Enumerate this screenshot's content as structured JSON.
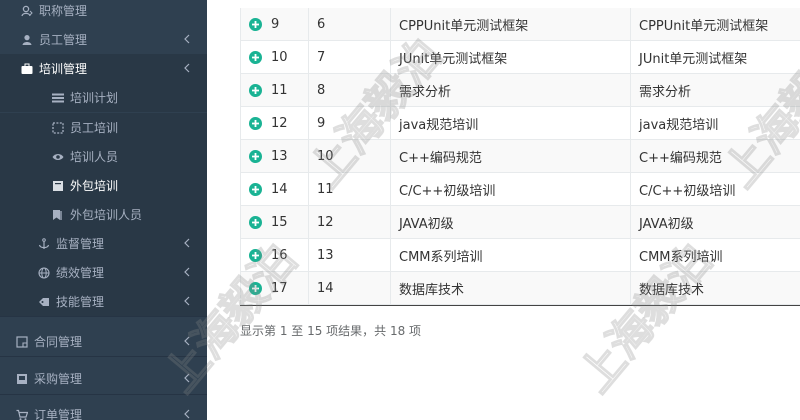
{
  "sidebar": {
    "items": [
      {
        "label": "职称管理",
        "icon": "user-tag-icon"
      },
      {
        "label": "员工管理",
        "icon": "user-icon"
      },
      {
        "label": "培训管理",
        "icon": "briefcase-icon"
      },
      {
        "label": "培训计划",
        "icon": "list-icon"
      },
      {
        "label": "员工培训",
        "icon": "crop-icon"
      },
      {
        "label": "培训人员",
        "icon": "eye-icon"
      },
      {
        "label": "外包培训",
        "icon": "book-icon"
      },
      {
        "label": "外包培训人员",
        "icon": "bookmark-icon"
      },
      {
        "label": "监督管理",
        "icon": "anchor-icon"
      },
      {
        "label": "绩效管理",
        "icon": "globe-icon"
      },
      {
        "label": "技能管理",
        "icon": "tag-icon"
      },
      {
        "label": "合同管理",
        "icon": "file-icon"
      },
      {
        "label": "采购管理",
        "icon": "inbox-icon"
      },
      {
        "label": "订单管理",
        "icon": "cart-icon"
      }
    ]
  },
  "table": {
    "rows": [
      {
        "no": "9",
        "id": "6",
        "name": "CPPUnit单元测试框架",
        "desc": "CPPUnit单元测试框架"
      },
      {
        "no": "10",
        "id": "7",
        "name": "JUnit单元测试框架",
        "desc": "JUnit单元测试框架"
      },
      {
        "no": "11",
        "id": "8",
        "name": "需求分析",
        "desc": "需求分析"
      },
      {
        "no": "12",
        "id": "9",
        "name": "java规范培训",
        "desc": "java规范培训"
      },
      {
        "no": "13",
        "id": "10",
        "name": "C++编码规范",
        "desc": "C++编码规范"
      },
      {
        "no": "14",
        "id": "11",
        "name": "C/C++初级培训",
        "desc": "C/C++初级培训"
      },
      {
        "no": "15",
        "id": "12",
        "name": "JAVA初级",
        "desc": "JAVA初级"
      },
      {
        "no": "16",
        "id": "13",
        "name": "CMM系列培训",
        "desc": "CMM系列培训"
      },
      {
        "no": "17",
        "id": "14",
        "name": "数据库技术",
        "desc": "数据库技术"
      }
    ]
  },
  "pagination": {
    "summary": "显示第 1 至 15 项结果，共 18 项"
  },
  "watermark": {
    "text": "上海毅泊"
  },
  "colors": {
    "sidebar_bg": "#2f4050",
    "sidebar_active_bg": "#293846",
    "accent": "#1ab394"
  }
}
